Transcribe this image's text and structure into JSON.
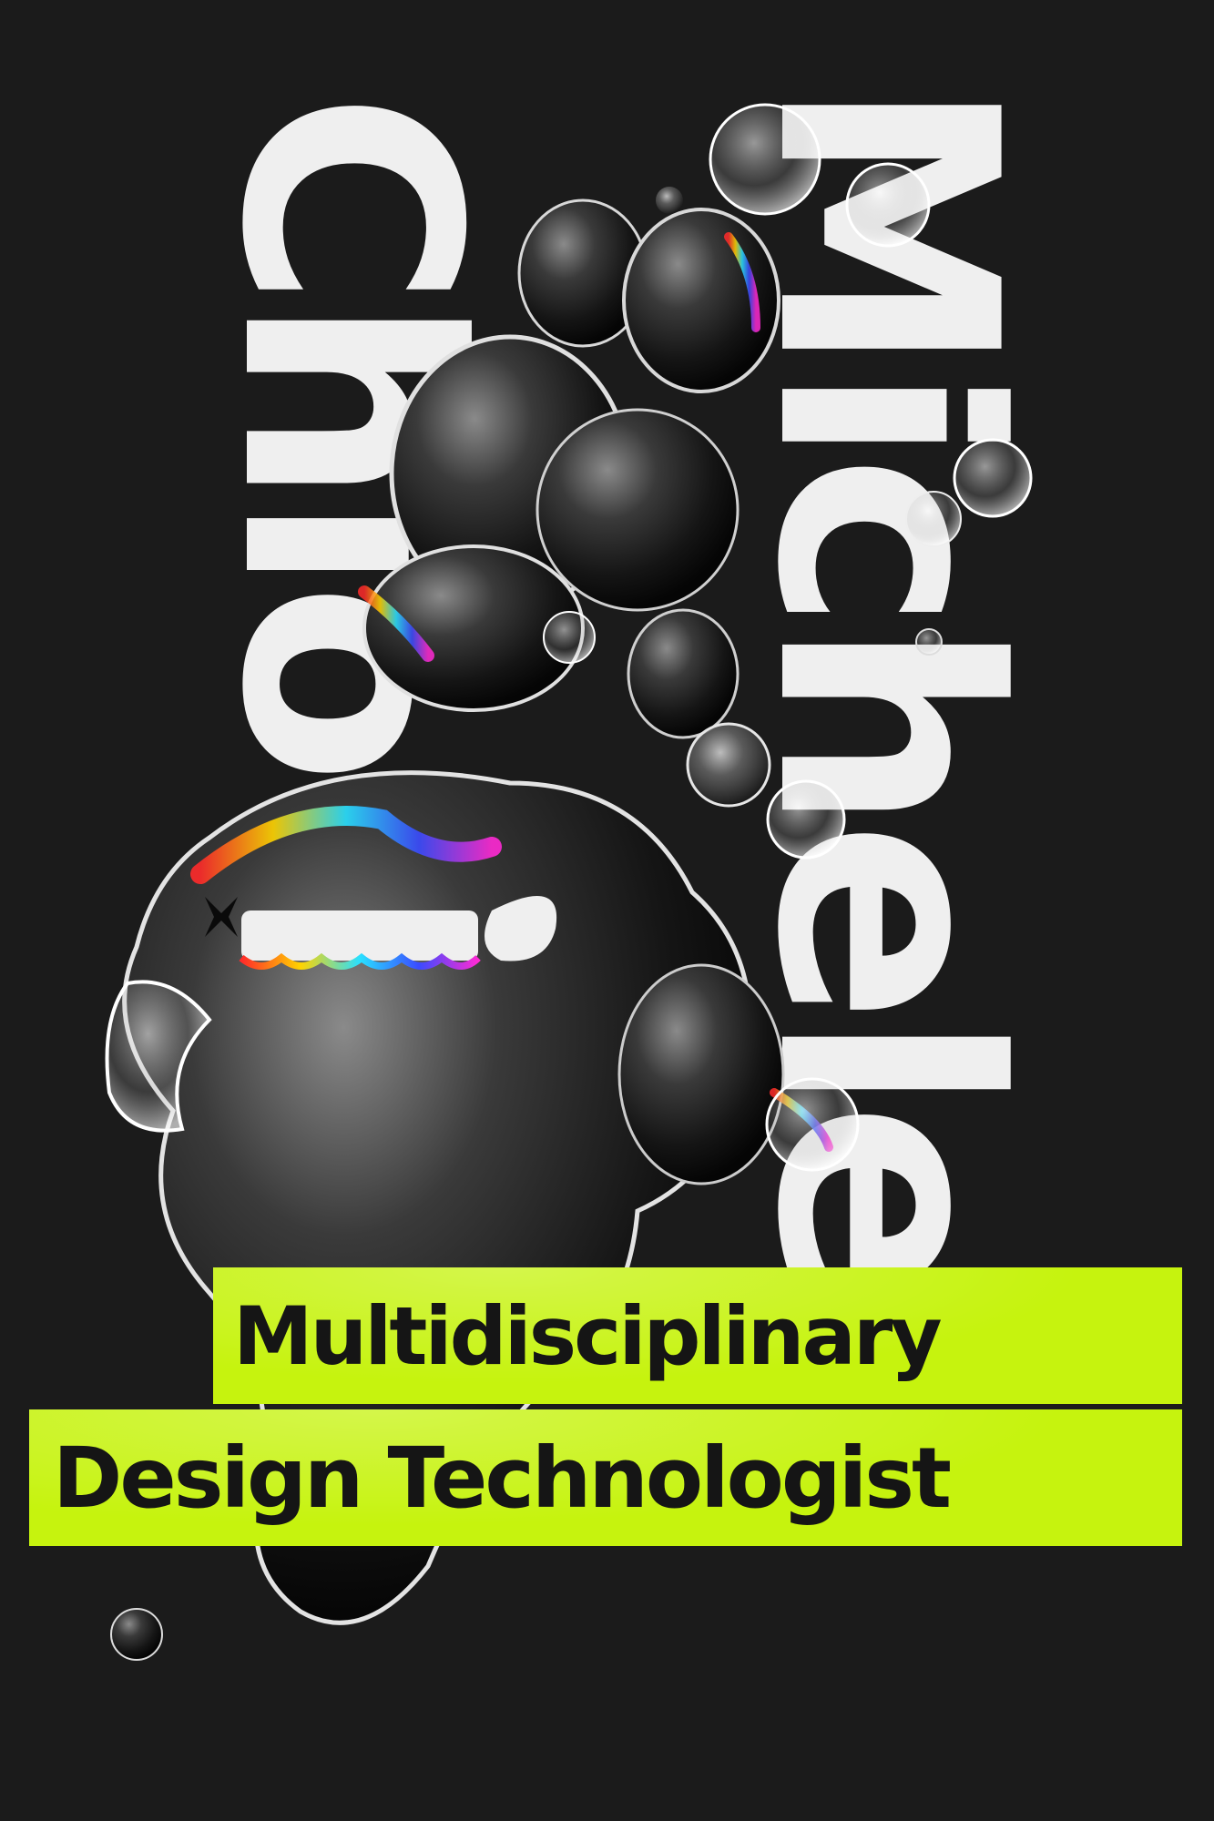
{
  "poster": {
    "name_first": "Michele",
    "name_last": "Chiodi",
    "tagline_line1": "Multidisciplinary",
    "tagline_line2": "Design Technologist"
  },
  "colors": {
    "background": "#1b1b1b",
    "name_text": "#efefef",
    "highlight": "#c6f30e",
    "tagline_text": "#151515"
  },
  "icons": [
    "glass-blob-illustration"
  ]
}
